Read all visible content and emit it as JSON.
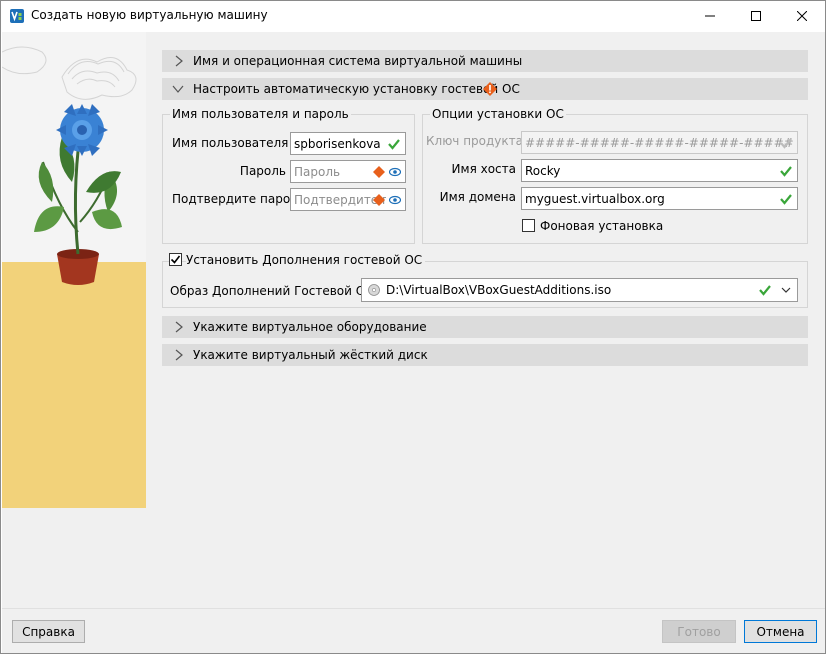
{
  "window": {
    "title": "Создать новую виртуальную машину"
  },
  "sections": {
    "name_os": "Имя и операционная система виртуальной машины",
    "unattended": "Настроить автоматическую установку гостевой ОС",
    "hardware": "Укажите виртуальное оборудование",
    "disk": "Укажите виртуальный жёсткий диск"
  },
  "user_group": {
    "title": "Имя пользователя и пароль",
    "username_label": "Имя пользователя",
    "username_value": "spborisenkova",
    "password_label": "Пароль",
    "password_placeholder": "Пароль",
    "confirm_label": "Подтвердите пароль",
    "confirm_placeholder": "Подтвердите па..."
  },
  "install_group": {
    "title": "Опции установки ОС",
    "product_key_label": "Ключ продукта",
    "product_key_value": "#####-#####-#####-#####-#####",
    "hostname_label": "Имя хоста",
    "hostname_value": "Rocky",
    "domain_label": "Имя домена",
    "domain_value": "myguest.virtualbox.org",
    "background_label": "Фоновая установка",
    "background_checked": false
  },
  "additions": {
    "checkbox_label": "Установить Дополнения гостевой ОС",
    "checked": true,
    "iso_label": "Образ Дополнений Гостевой ОС:",
    "iso_value": "D:\\VirtualBox\\VBoxGuestAdditions.iso"
  },
  "buttons": {
    "help": "Справка",
    "finish": "Готово",
    "cancel": "Отмена"
  },
  "colors": {
    "valid_check": "#3aa63a",
    "warning_orange": "#e8601c",
    "section_bg": "#dcdcdc",
    "art_yellow": "#f2d27a",
    "flower_blue": "#3a82d4"
  }
}
